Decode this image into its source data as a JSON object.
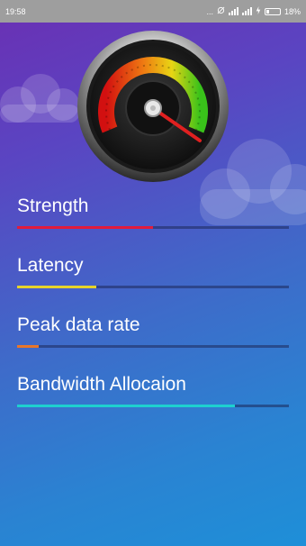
{
  "status_bar": {
    "time": "19:58",
    "dots": "...",
    "battery_percent": "18%"
  },
  "metrics": [
    {
      "label": "Strength",
      "progress": 0.5,
      "color": "#e21b3c"
    },
    {
      "label": "Latency",
      "progress": 0.29,
      "color": "#e6d32a"
    },
    {
      "label": "Peak data rate",
      "progress": 0.08,
      "color": "#e8762a"
    },
    {
      "label": "Bandwidth Allocaion",
      "progress": 0.8,
      "color": "#1ed0cf"
    }
  ],
  "icons": {
    "gauge": "speedometer-icon",
    "clouds": "cloud-icon"
  }
}
